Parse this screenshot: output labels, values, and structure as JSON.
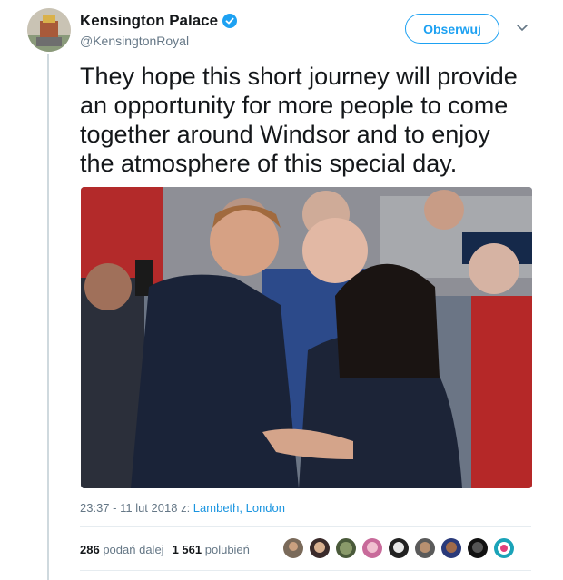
{
  "account": {
    "name": "Kensington Palace",
    "handle": "@KensingtonRoyal"
  },
  "follow_label": "Obserwuj",
  "tweet": {
    "text_lines": [
      "They hope this short journey will provide",
      "an opportunity for more people to come",
      "together around Windsor and to enjoy",
      "the atmosphere of this special day."
    ]
  },
  "meta": {
    "time_date": "23:37 - 11 lut 2018 z: ",
    "location": "Lambeth, London"
  },
  "stats": {
    "retweets": "286",
    "retweets_label": "podań dalej",
    "likes": "1 561",
    "likes_label": "polubień"
  },
  "colors": {
    "accent": "#1da1f2",
    "link": "#1b95e0",
    "muted": "#657786"
  }
}
